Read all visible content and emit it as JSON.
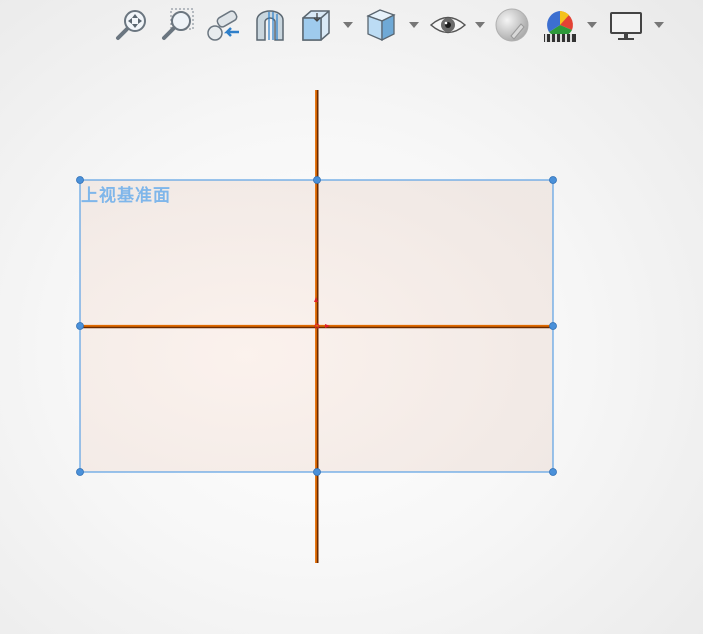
{
  "toolbar": {
    "buttons": [
      {
        "icon": "zoom-to-fit-icon"
      },
      {
        "icon": "zoom-to-area-icon"
      },
      {
        "icon": "previous-view-icon"
      },
      {
        "icon": "section-view-icon"
      },
      {
        "icon": "view-orientation-icon",
        "has_dropdown": true
      },
      {
        "icon": "display-style-icon",
        "has_dropdown": true
      },
      {
        "icon": "hide-show-items-icon",
        "has_dropdown": true
      },
      {
        "icon": "edit-appearance-icon"
      },
      {
        "icon": "apply-scene-icon",
        "has_dropdown": true
      },
      {
        "icon": "view-settings-icon",
        "has_dropdown": true
      }
    ]
  },
  "plane": {
    "label": "上视基准面",
    "fill_color": "#fbf1ec",
    "border_color": "#5aa0e4",
    "handle_color": "#4a90d9"
  },
  "axes": {
    "color": "#e06a00",
    "shadow_color": "#6b2a00"
  }
}
